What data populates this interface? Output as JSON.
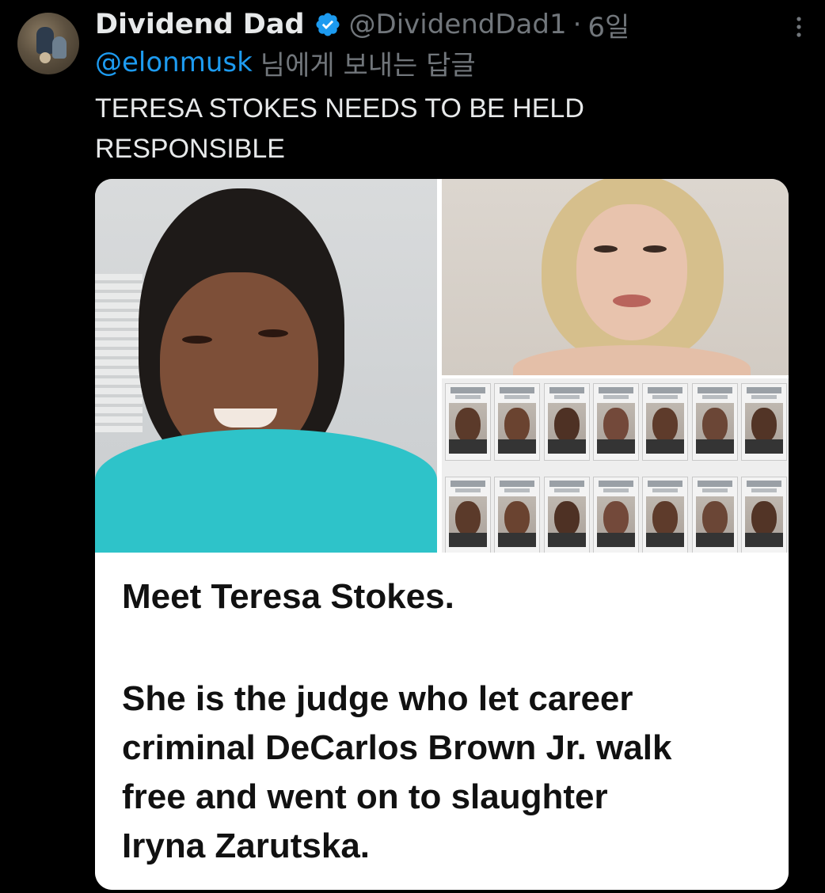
{
  "tweet": {
    "author": {
      "display_name": "Dividend Dad",
      "verified": true,
      "handle": "@DividendDad1",
      "separator": "·",
      "time": "6일"
    },
    "reply_to": {
      "mention": "@elonmusk",
      "suffix": "님에게 보내는 답글"
    },
    "text_lines": [
      "TERESA STOKES NEEDS TO BE HELD",
      "RESPONSIBLE"
    ],
    "media": {
      "caption_heading": "Meet Teresa Stokes.",
      "caption_lines": [
        "She is the judge who let career",
        "criminal DeCarlos Brown Jr. walk",
        "free and went on to slaughter",
        "Iryna Zarutska."
      ],
      "mugshot_count": 14
    }
  },
  "icons": {
    "verified": "verified-badge-icon",
    "more": "more-options-icon"
  },
  "colors": {
    "background": "#000000",
    "text_primary": "#e7e9ea",
    "text_secondary": "#71767b",
    "link": "#1d9bf0",
    "verified_badge": "#1d9bf0"
  }
}
